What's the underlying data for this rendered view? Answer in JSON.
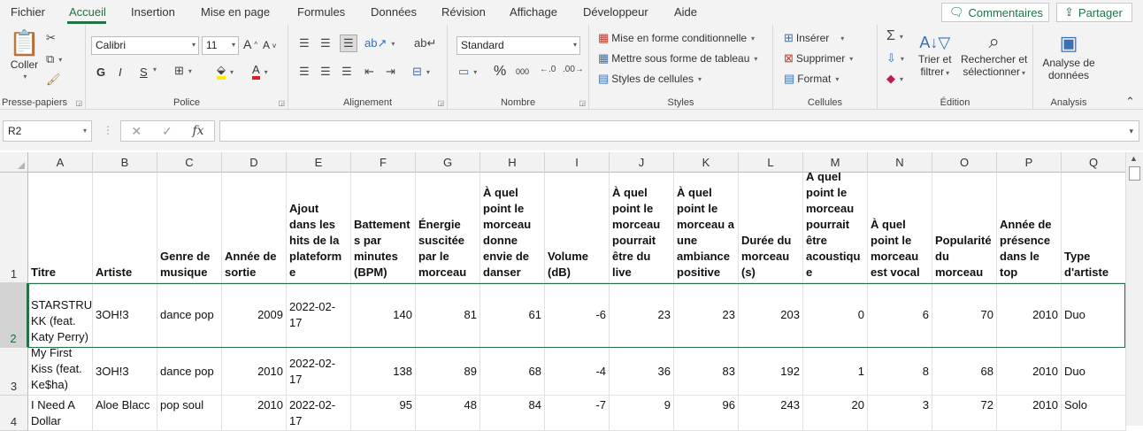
{
  "tabs": [
    "Fichier",
    "Accueil",
    "Insertion",
    "Mise en page",
    "Formules",
    "Données",
    "Révision",
    "Affichage",
    "Développeur",
    "Aide"
  ],
  "top_buttons": {
    "comments": "Commentaires",
    "share": "Partager"
  },
  "ribbon": {
    "clipboard": {
      "paste": "Coller",
      "label": "Presse-papiers"
    },
    "font": {
      "name": "Calibri",
      "size": "11",
      "bold": "G",
      "italic": "I",
      "underline": "S",
      "label": "Police",
      "grow": "A",
      "shrink": "A",
      "color_letter": "A"
    },
    "alignment": {
      "label": "Alignement"
    },
    "number": {
      "format": "Standard",
      "label": "Nombre",
      "percent": "%",
      "thousands": "000"
    },
    "styles": {
      "conditional": "Mise en forme conditionnelle",
      "table": "Mettre sous forme de tableau",
      "cell_styles": "Styles de cellules",
      "label": "Styles"
    },
    "cells": {
      "insert": "Insérer",
      "delete": "Supprimer",
      "format": "Format",
      "label": "Cellules"
    },
    "editing": {
      "sort_l1": "Trier et",
      "sort_l2": "filtrer",
      "find_l1": "Rechercher et",
      "find_l2": "sélectionner",
      "label": "Édition"
    },
    "analysis": {
      "l1": "Analyse de",
      "l2": "données",
      "label": "Analysis"
    }
  },
  "name_box": "R2",
  "formula_bar": {
    "cancel": "✕",
    "enter": "✓",
    "fx": "fx",
    "value": ""
  },
  "columns": [
    "A",
    "B",
    "C",
    "D",
    "E",
    "F",
    "G",
    "H",
    "I",
    "J",
    "K",
    "L",
    "M",
    "N",
    "O",
    "P",
    "Q"
  ],
  "rows": [
    "1",
    "2",
    "3",
    "4"
  ],
  "headers": [
    "Titre",
    "Artiste",
    "Genre de musique",
    "Année de sortie",
    "Ajout dans les hits de la plateform e",
    "Battement s par minutes (BPM)",
    "Énergie suscitée par le morceau",
    "À quel point le morceau donne envie de danser",
    "Volume (dB)",
    "À quel point le morceau pourrait être du live",
    "À quel point le morceau a une ambiance positive",
    "Durée du morceau (s)",
    "À quel point le morceau pourrait être acoustiqu e",
    "À quel point le morceau est vocal",
    "Popularité du morceau",
    "Année de présence dans le top",
    "Type d'artiste"
  ],
  "data": [
    [
      "STARSTRU KK (feat. Katy Perry)",
      "3OH!3",
      "dance pop",
      "2009",
      "2022-02-17",
      "140",
      "81",
      "61",
      "-6",
      "23",
      "23",
      "203",
      "0",
      "6",
      "70",
      "2010",
      "Duo"
    ],
    [
      "My First Kiss (feat. Ke$ha)",
      "3OH!3",
      "dance pop",
      "2010",
      "2022-02-17",
      "138",
      "89",
      "68",
      "-4",
      "36",
      "83",
      "192",
      "1",
      "8",
      "68",
      "2010",
      "Duo"
    ],
    [
      "I Need A Dollar",
      "Aloe Blacc",
      "pop soul",
      "2010",
      "2022-02-17",
      "95",
      "48",
      "84",
      "-7",
      "9",
      "96",
      "243",
      "20",
      "3",
      "72",
      "2010",
      "Solo"
    ]
  ]
}
